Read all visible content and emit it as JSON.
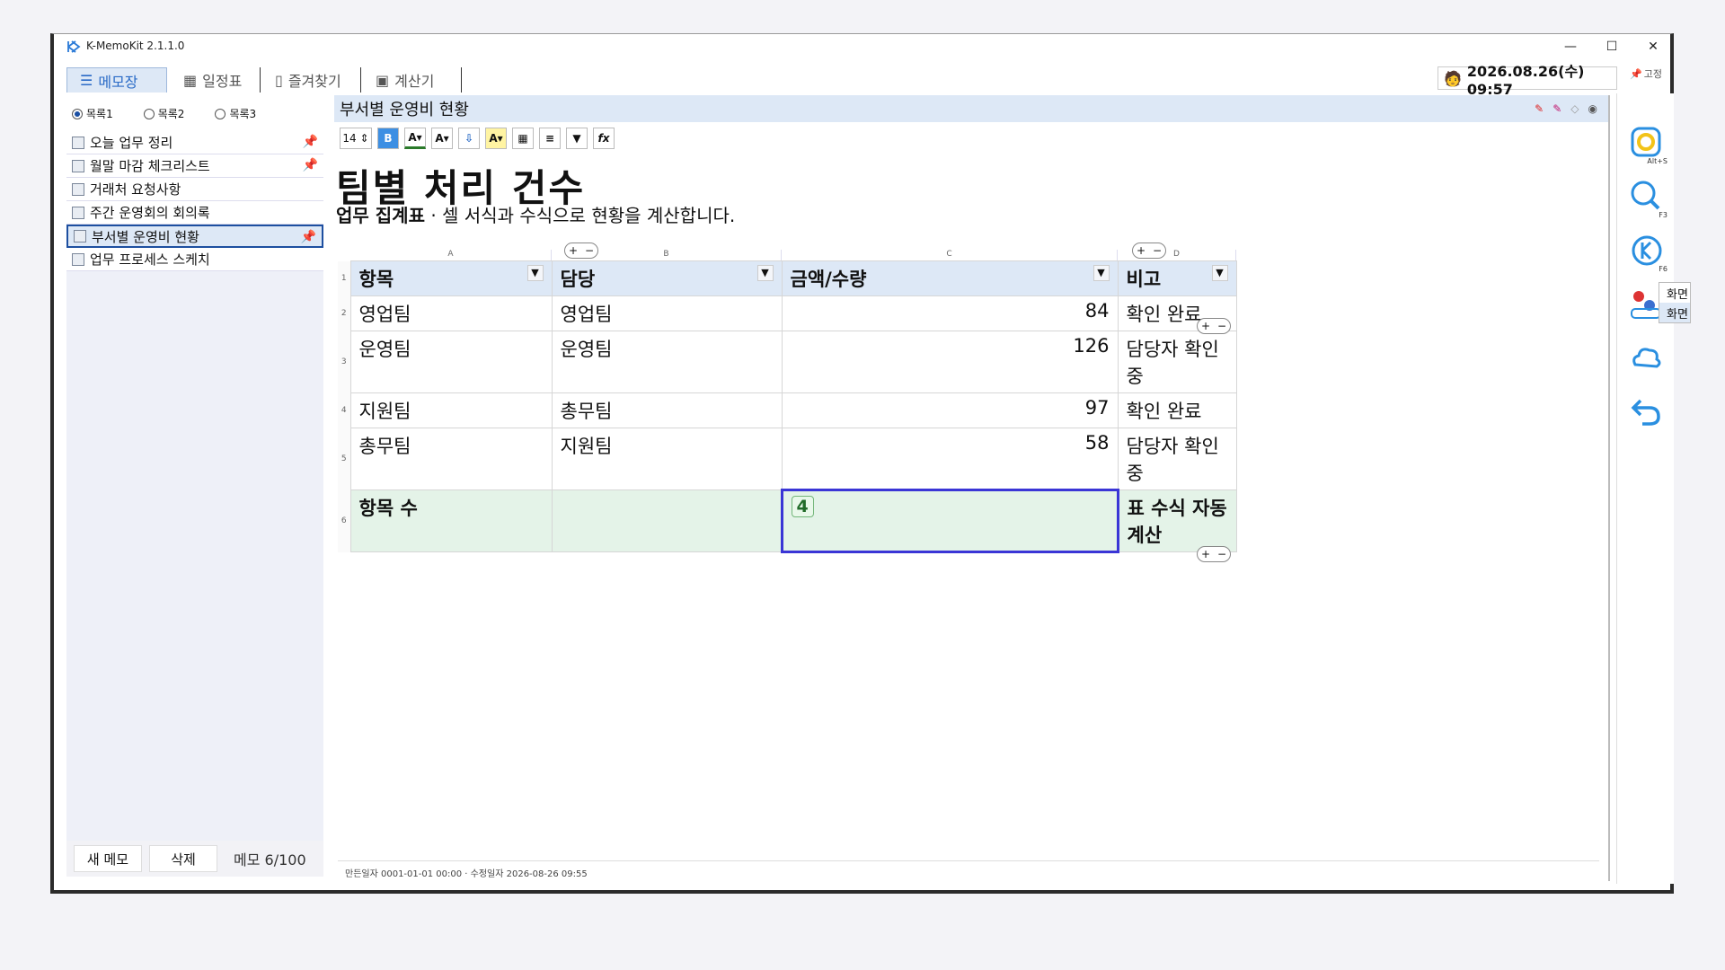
{
  "window": {
    "title": "K-MemoKit 2.1.1.0",
    "minimize": "—",
    "maximize": "☐",
    "close": "✕"
  },
  "tabs": [
    {
      "label": "메모장",
      "icon": "memo-icon"
    },
    {
      "label": "일정표",
      "icon": "calendar-icon"
    },
    {
      "label": "즐겨찾기",
      "icon": "bookmark-icon"
    },
    {
      "label": "계산기",
      "icon": "calculator-icon"
    }
  ],
  "clock": "2026.08.26(수) 09:57",
  "pin_label": "고정",
  "sidebar": {
    "lists": [
      "목록1",
      "목록2",
      "목록3"
    ],
    "selected_list": "목록1",
    "memos": [
      {
        "title": "오늘 업무 정리",
        "pinned": true
      },
      {
        "title": "월말 마감 체크리스트",
        "pinned": true
      },
      {
        "title": "거래처 요청사항",
        "pinned": false
      },
      {
        "title": "주간 운영회의 회의록",
        "pinned": false
      },
      {
        "title": "부서별 운영비 현황",
        "pinned": true,
        "selected": true
      },
      {
        "title": "업무 프로세스 스케치",
        "pinned": false
      }
    ],
    "new_button": "새 메모",
    "delete_button": "삭제",
    "count": "메모 6/100"
  },
  "editor": {
    "memo_title": "부서별 운영비 현황",
    "font_size": "14",
    "doc_title": "팀별 처리 건수",
    "subtitle_bold": "업무 집계표",
    "subtitle_rest": " · 셀 서식과 수식으로 현황을 계산합니다.",
    "sheet": {
      "columns": [
        "A",
        "B",
        "C",
        "D"
      ],
      "headers": [
        "항목",
        "담당",
        "금액/수량",
        "비고"
      ],
      "rows": [
        {
          "n": "2",
          "a": "영업팀",
          "b": "영업팀",
          "c": "84",
          "d": "확인 완료"
        },
        {
          "n": "3",
          "a": "운영팀",
          "b": "운영팀",
          "c": "126",
          "d": "담당자 확인 중"
        },
        {
          "n": "4",
          "a": "지원팀",
          "b": "총무팀",
          "c": "97",
          "d": "확인 완료"
        },
        {
          "n": "5",
          "a": "총무팀",
          "b": "지원팀",
          "c": "58",
          "d": "담당자 확인 중"
        }
      ],
      "summary": {
        "n": "6",
        "a": "항목 수",
        "b": "",
        "c": "4",
        "d": "표 수식 자동 계산"
      }
    },
    "status": "만든일자 0001-01-01 00:00 · 수정일자 2026-08-26 09:55"
  },
  "rail": {
    "hotkeys": [
      "Alt+S",
      "F3",
      "F6"
    ],
    "tooltip": [
      "화면 캡",
      "화면 녹"
    ]
  },
  "colors": {
    "accent": "#2a6bc7",
    "header_fill": "#dde8f6",
    "summary_fill": "#e4f3e8",
    "selection": "#3a35d6"
  }
}
